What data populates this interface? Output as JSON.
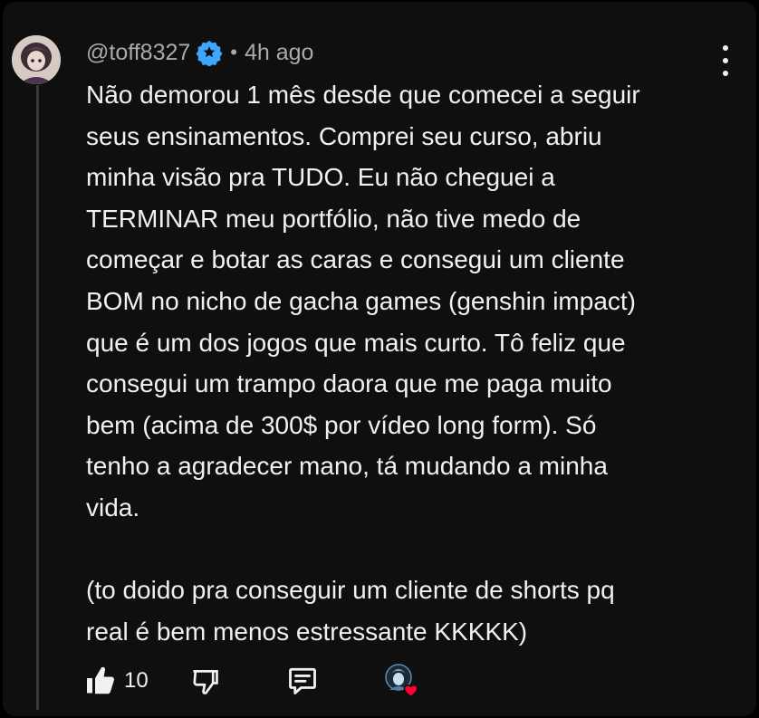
{
  "comment": {
    "username": "@toff8327",
    "separator": "•",
    "time_ago": "4h ago",
    "text": "Não demorou 1 mês desde que comecei a seguir\nseus ensinamentos. Comprei seu curso, abriu\nminha visão pra TUDO. Eu não cheguei a\nTERMINAR meu portfólio, não tive medo de\ncomeçar e botar as caras e consegui um cliente\nBOM no nicho de gacha games (genshin impact)\nque é um dos jogos que mais curto. Tô feliz que\nconsegui um trampo daora que me paga muito\nbem (acima de 300$ por vídeo long form). Só\ntenho a agradecer mano, tá mudando a minha\nvida.\n\n(to doido pra conseguir um cliente de shorts pq\nreal é bem menos estressante KKKKK)",
    "like_count": "10"
  },
  "icons": {
    "verified": "verified-badge-icon",
    "more": "more-vert-icon",
    "like": "thumbs-up-icon",
    "dislike": "thumbs-down-icon",
    "reply": "reply-comment-icon",
    "creator_heart": "creator-heart-icon"
  },
  "colors": {
    "background": "#0f0f0f",
    "text": "#f1f1f1",
    "meta_text": "#aaaaaa",
    "verified": "#3ea6ff",
    "heart": "#ff0033"
  }
}
